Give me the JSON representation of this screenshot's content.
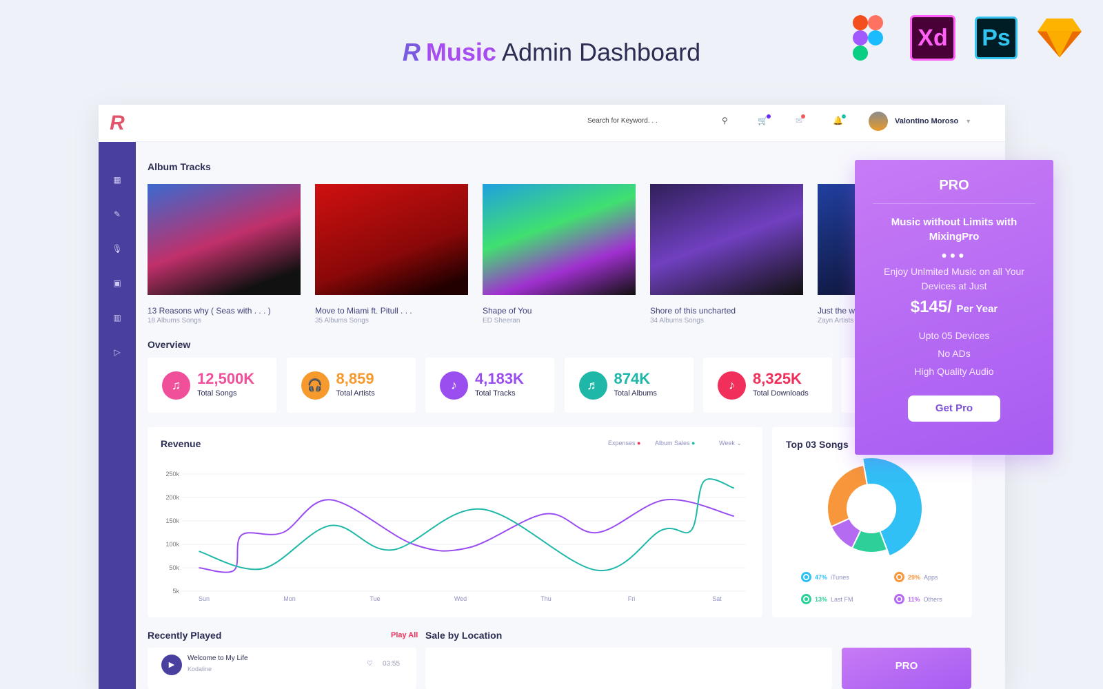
{
  "header": {
    "logo_text": "R",
    "brand": "Music",
    "title": "Admin Dashboard"
  },
  "tools": [
    {
      "name": "figma-icon"
    },
    {
      "label": "Xd"
    },
    {
      "label": "Ps"
    },
    {
      "name": "sketch-icon"
    }
  ],
  "topbar": {
    "search_placeholder": "Search for Keyword. . .",
    "user_name": "Valontino Moroso",
    "badges": {
      "cart": "#6c2bf0",
      "mail": "#f05a5a",
      "bell": "#20c0a8"
    }
  },
  "sidebar": {
    "items": [
      "dashboard-icon",
      "edit-icon",
      "mic-icon",
      "note-icon",
      "bar-chart-icon",
      "play-box-icon"
    ]
  },
  "albums": {
    "title": "Album Tracks",
    "items": [
      {
        "title": "13 Reasons why ( Seas with . . . )",
        "sub": "18 Albums Songs"
      },
      {
        "title": "Move to Miami ft. Pitull . . .",
        "sub": "35 Albums Songs"
      },
      {
        "title": "Shape of You",
        "sub": "ED Sheeran"
      },
      {
        "title": "Shore of this uncharted",
        "sub": "34 Albums Songs"
      },
      {
        "title": "Just the w",
        "sub": "Zayn Artists"
      }
    ]
  },
  "overview": {
    "title": "Overview",
    "stats": [
      {
        "value": "12,500K",
        "label": "Total Songs",
        "color": "#f0509a"
      },
      {
        "value": "8,859",
        "label": "Total Artists",
        "color": "#f79a2e"
      },
      {
        "value": "4,183K",
        "label": "Total Tracks",
        "color": "#9a4ef0"
      },
      {
        "value": "874K",
        "label": "Total Albums",
        "color": "#1fb8a8"
      },
      {
        "value": "8,325K",
        "label": "Total Downloads",
        "color": "#f0305a"
      }
    ]
  },
  "revenue": {
    "title": "Revenue",
    "legend": [
      {
        "label": "Expenses",
        "color": "#f0305a"
      },
      {
        "label": "Album Sales",
        "color": "#1fb8a8"
      }
    ],
    "period": "Week"
  },
  "chart_data": {
    "type": "line",
    "categories": [
      "Sun",
      "Mon",
      "Tue",
      "Wed",
      "Thu",
      "Fri",
      "Sat"
    ],
    "yticks": [
      "5k",
      "50k",
      "100k",
      "150k",
      "200k",
      "250k"
    ],
    "ylim": [
      5,
      250
    ],
    "grid": true,
    "series": [
      {
        "color": "#9a4ef0",
        "points": [
          [
            -0.06,
            50
          ],
          [
            0.35,
            45
          ],
          [
            0.44,
            120
          ],
          [
            0.92,
            125
          ],
          [
            1.48,
            195
          ],
          [
            2.45,
            100
          ],
          [
            3.1,
            93
          ],
          [
            4.0,
            165
          ],
          [
            4.6,
            125
          ],
          [
            5.4,
            195
          ],
          [
            6.2,
            160
          ]
        ]
      },
      {
        "color": "#1fb8a8",
        "points": [
          [
            -0.06,
            85
          ],
          [
            0.68,
            48
          ],
          [
            1.48,
            140
          ],
          [
            2.2,
            88
          ],
          [
            3.25,
            175
          ],
          [
            4.6,
            45
          ],
          [
            5.35,
            130
          ],
          [
            5.7,
            130
          ],
          [
            5.85,
            235
          ],
          [
            6.2,
            220
          ]
        ]
      }
    ]
  },
  "top_songs": {
    "title": "Top 03 Songs",
    "slices": [
      {
        "pct": "47%",
        "label": "iTunes",
        "value": 47,
        "color": "#30c0f5"
      },
      {
        "pct": "13%",
        "label": "Last FM",
        "value": 13,
        "color": "#2ed09a"
      },
      {
        "pct": "11%",
        "label": "Others",
        "value": 11,
        "color": "#b56af2"
      },
      {
        "pct": "29%",
        "label": "Apps",
        "value": 29,
        "color": "#f7963a"
      }
    ]
  },
  "recent": {
    "title": "Recently Played",
    "play_all": "Play All",
    "items": [
      {
        "title": "Welcome to My Life",
        "artist": "Kodaline",
        "time": "03:55"
      }
    ]
  },
  "sale": {
    "title": "Sale by Location"
  },
  "pro": {
    "title": "PRO",
    "headline": "Music without Limits with MixingPro",
    "desc": "Enjoy Unlmited Music on all Your Devices at Just",
    "price": "$145/",
    "per": "Per Year",
    "features": [
      "Upto 05 Devices",
      "No ADs",
      "High Quality Audio"
    ],
    "button": "Get Pro",
    "mini_title": "PRO"
  }
}
